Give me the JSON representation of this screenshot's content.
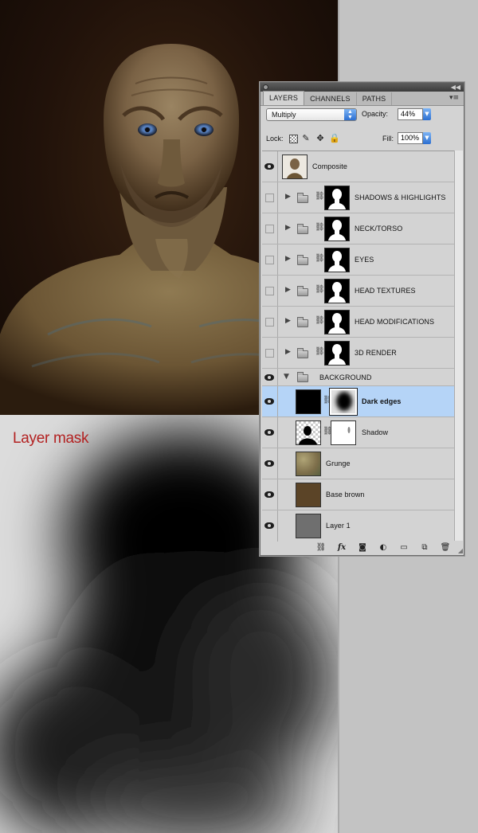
{
  "annotation": {
    "title": "Layer mask"
  },
  "panel": {
    "tabs": [
      {
        "label": "LAYERS",
        "active": true
      },
      {
        "label": "CHANNELS",
        "active": false
      },
      {
        "label": "PATHS",
        "active": false
      }
    ],
    "blend_mode": "Multiply",
    "opacity_label": "Opacity:",
    "opacity_value": "44%",
    "lock_label": "Lock:",
    "fill_label": "Fill:",
    "fill_value": "100%",
    "layers": [
      {
        "name": "Composite",
        "type": "layer",
        "visible": true
      },
      {
        "name": "SHADOWS & HIGHLIGHTS",
        "type": "group",
        "visible": false
      },
      {
        "name": "NECK/TORSO",
        "type": "group",
        "visible": false
      },
      {
        "name": "EYES",
        "type": "group",
        "visible": false
      },
      {
        "name": "HEAD TEXTURES",
        "type": "group",
        "visible": false
      },
      {
        "name": "HEAD MODIFICATIONS",
        "type": "group",
        "visible": false
      },
      {
        "name": "3D RENDER",
        "type": "group",
        "visible": false
      },
      {
        "name": "BACKGROUND",
        "type": "group-open",
        "visible": true
      },
      {
        "name": "Dark edges",
        "type": "layer-mask",
        "visible": true,
        "selected": true
      },
      {
        "name": "Shadow",
        "type": "layer-mask",
        "visible": true
      },
      {
        "name": "Grunge",
        "type": "layer",
        "visible": true
      },
      {
        "name": "Base brown",
        "type": "layer",
        "visible": true
      },
      {
        "name": "Layer 1",
        "type": "layer",
        "visible": true
      }
    ]
  },
  "colors": {
    "selection": "#b5d4f7",
    "annotation": "#b32222"
  }
}
